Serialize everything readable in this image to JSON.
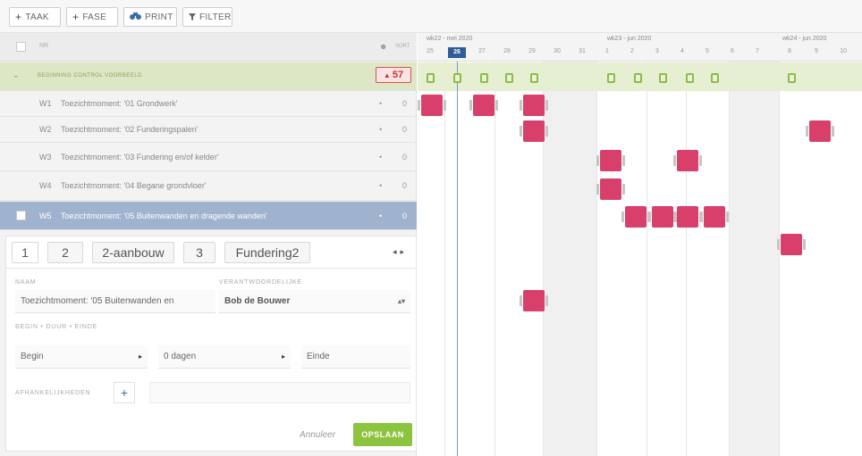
{
  "toolbar": {
    "buttons": [
      {
        "icon": "plus-icon",
        "label": "TAAK"
      },
      {
        "icon": "plus-icon",
        "label": "FASE"
      },
      {
        "icon": "binoculars-icon",
        "label": "PRINT"
      },
      {
        "icon": "funnel-icon",
        "label": "FILTER"
      }
    ]
  },
  "list": {
    "header_name": "NR",
    "header_sort": "SORT",
    "group": {
      "title": "BEGINNING CONTROL VOORBEELD",
      "count": "57"
    },
    "rows": [
      {
        "code": "W1",
        "title": "Toezichtmoment: '01 Grondwerk'",
        "dot": "•",
        "count": "0"
      },
      {
        "code": "W2",
        "title": "Toezichtmoment: '02 Funderingspalen'",
        "dot": "•",
        "count": "0"
      },
      {
        "code": "W3",
        "title": "Toezichtmoment: '03 Fundering en/of kelder'",
        "dot": "•",
        "count": "0"
      },
      {
        "code": "W4",
        "title": "Toezichtmoment: '04 Begane grondvloer'",
        "dot": "•",
        "count": "0"
      },
      {
        "code": "W5",
        "title": "Toezichtmoment: '05 Buitenwanden en dragende wanden'",
        "dot": "•",
        "count": "0"
      }
    ]
  },
  "form": {
    "tabs": [
      "1",
      "2",
      "2-aanbouw",
      "3",
      "Fundering2"
    ],
    "naam_label": "NAAM",
    "naam_value": "Toezichtmoment: '05 Buitenwanden en",
    "verantwoordelijke_label": "VERANTWOORDELIJKE",
    "verantwoordelijke_value": "Bob de Bouwer",
    "period_label": "BEGIN • DUUR • EINDE",
    "begin_value": "Begin",
    "duur_value": "0 dagen",
    "einde_value": "Einde",
    "afhankelijkheden_label": "AFHANKELIJKHEDEN",
    "cancel_label": "Annuleer",
    "save_label": "OPSLAAN"
  },
  "gantt": {
    "weeks": [
      {
        "label": "wk22 - mei 2020"
      },
      {
        "label": "wk23 - jun 2020"
      },
      {
        "label": "wk24 - jun 2020"
      }
    ],
    "days": [
      "25",
      "26",
      "27",
      "28",
      "29",
      "30",
      "31",
      "1",
      "2",
      "3",
      "4",
      "5",
      "6",
      "7",
      "8",
      "9",
      "10"
    ],
    "today": "26",
    "colors": {
      "task": "#d93f6b",
      "milestone": "#8cbc4a",
      "today": "#2f5d9a"
    }
  }
}
